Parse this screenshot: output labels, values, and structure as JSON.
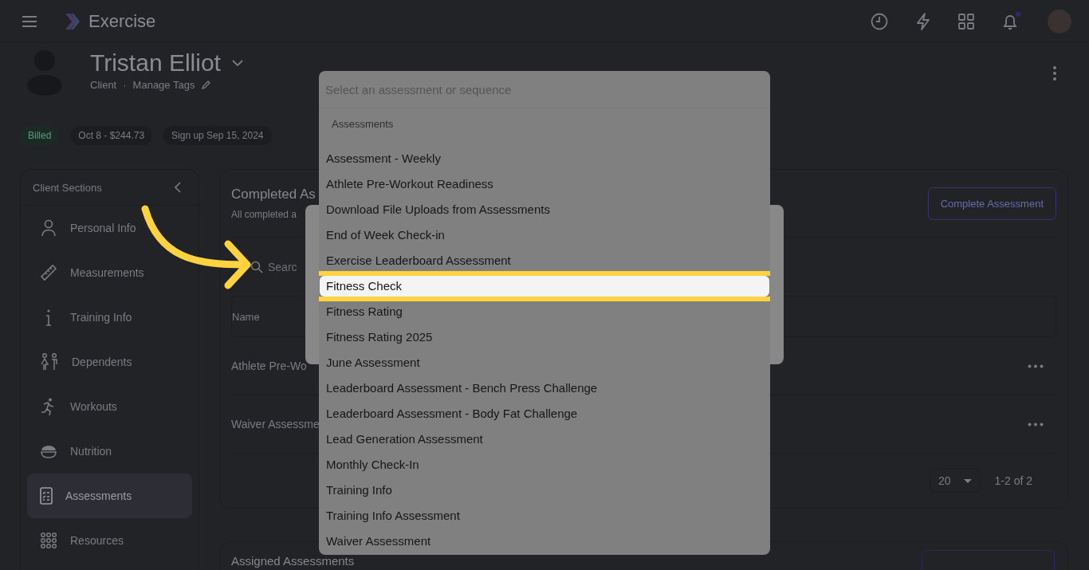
{
  "app": {
    "title": "Exercise"
  },
  "client": {
    "name": "Tristan Elliot",
    "role": "Client",
    "separator": "·",
    "manage_tags": "Manage Tags"
  },
  "tags": [
    {
      "label": "Billed",
      "kind": "status"
    },
    {
      "label": "Oct 8 - $244.73",
      "kind": "plain"
    },
    {
      "label": "Sign up Sep 15, 2024",
      "kind": "plain"
    }
  ],
  "sidebar": {
    "title": "Client Sections",
    "items": [
      {
        "label": "Personal Info",
        "selected": false
      },
      {
        "label": "Measurements",
        "selected": false
      },
      {
        "label": "Training Info",
        "selected": false
      },
      {
        "label": "Dependents",
        "selected": false
      },
      {
        "label": "Workouts",
        "selected": false
      },
      {
        "label": "Nutrition",
        "selected": false
      },
      {
        "label": "Assessments",
        "selected": true
      },
      {
        "label": "Resources",
        "selected": false
      }
    ]
  },
  "completed": {
    "title": "Completed As",
    "subtitle": "All completed a",
    "button": "Complete Assessment",
    "search_placeholder": "Searc",
    "columns": [
      "Name"
    ],
    "rows": [
      {
        "name": "Athlete Pre-Wo"
      },
      {
        "name": "Waiver Assessme"
      }
    ],
    "page_size": "20",
    "range": "1-2 of 2"
  },
  "assigned": {
    "title": "Assigned Assessments"
  },
  "dropdown": {
    "placeholder": "Select an assessment or sequence",
    "group": "Assessments",
    "items": [
      {
        "label": "Assessment - Weekly",
        "selected": false
      },
      {
        "label": "Athlete Pre-Workout Readiness",
        "selected": false
      },
      {
        "label": "Download File Uploads from Assessments",
        "selected": false
      },
      {
        "label": "End of Week Check-in",
        "selected": false
      },
      {
        "label": "Exercise Leaderboard Assessment",
        "selected": false
      },
      {
        "label": "Fitness Check",
        "selected": true
      },
      {
        "label": "Fitness Rating",
        "selected": false
      },
      {
        "label": "Fitness Rating 2025",
        "selected": false
      },
      {
        "label": "June Assessment",
        "selected": false
      },
      {
        "label": "Leaderboard Assessment - Bench Press Challenge",
        "selected": false
      },
      {
        "label": "Leaderboard Assessment - Body Fat Challenge",
        "selected": false
      },
      {
        "label": "Lead Generation Assessment",
        "selected": false
      },
      {
        "label": "Monthly Check-In",
        "selected": false
      },
      {
        "label": "Training Info",
        "selected": false
      },
      {
        "label": "Training Info Assessment",
        "selected": false
      },
      {
        "label": "Waiver Assessment",
        "selected": false
      }
    ]
  }
}
